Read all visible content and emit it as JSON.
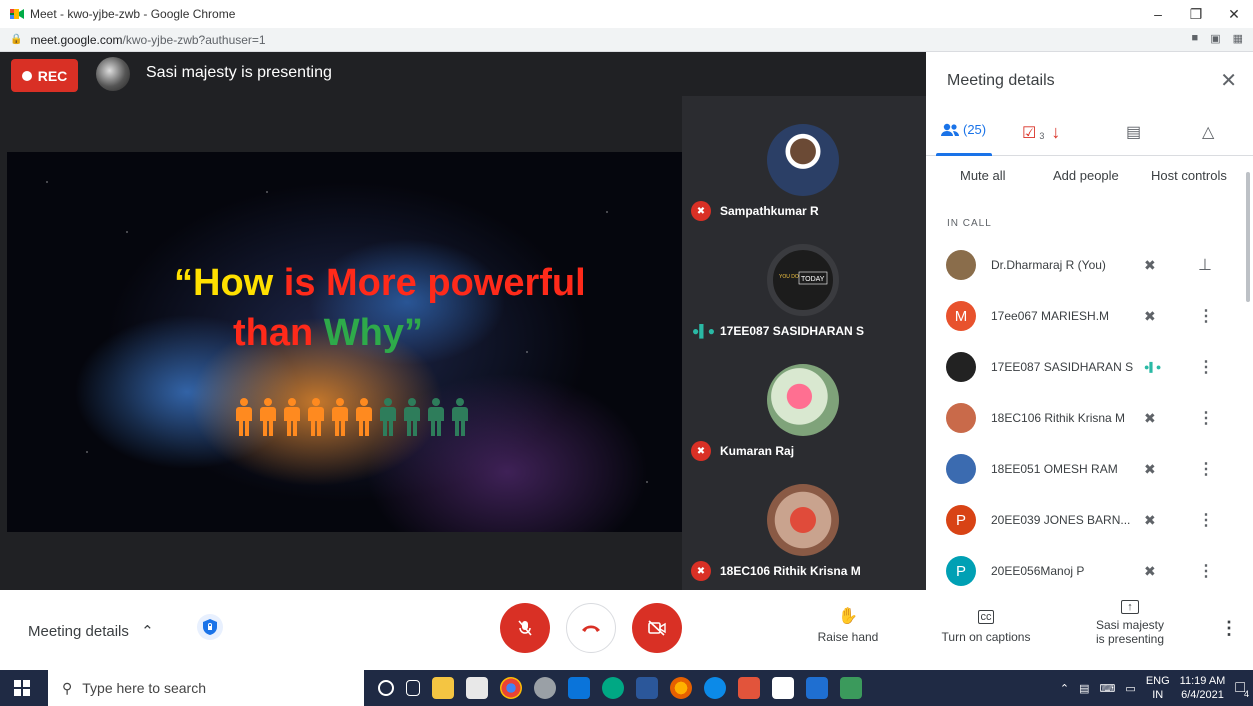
{
  "browser": {
    "title": "Meet - kwo-yjbe-zwb - Google Chrome",
    "url_host": "meet.google.com",
    "url_path": "/kwo-yjbe-zwb?authuser=1"
  },
  "stage": {
    "rec_label": "REC",
    "presenter_text": "Sasi majesty is presenting"
  },
  "slide": {
    "line1": [
      {
        "text": "“How ",
        "color": "#ffe000"
      },
      {
        "text": "is More powerful",
        "color": "#ff2a1a"
      }
    ],
    "line2": [
      {
        "text": "than ",
        "color": "#ff2a1a"
      },
      {
        "text": "Why”",
        "color": "#2eaa4a"
      }
    ],
    "people_orange": 6,
    "people_green": 4,
    "colors": {
      "orange": "#ff8a1f",
      "green": "#2e7d5b"
    }
  },
  "tiles": [
    {
      "name": "Sampathkumar R",
      "state": "muted"
    },
    {
      "name": "17EE087 SASIDHARAN S",
      "state": "speaking"
    },
    {
      "name": "Kumaran Raj",
      "state": "muted"
    },
    {
      "name": "18EC106 Rithik Krisna M",
      "state": "muted"
    }
  ],
  "panel": {
    "title": "Meeting details",
    "people_count": "(25)",
    "tasks_count": "3",
    "actions": {
      "mute_all": "Mute all",
      "add_people": "Add people",
      "host_controls": "Host controls"
    },
    "in_call_label": "IN CALL",
    "participants": [
      {
        "name": "Dr.Dharmaraj R (You)",
        "initial": "",
        "color": "#8a6d4b"
      },
      {
        "name": "17ee067 MARIESH.M",
        "initial": "M",
        "color": "#e8522d"
      },
      {
        "name": "17EE087 SASIDHARAN S",
        "initial": "",
        "color": "#222222"
      },
      {
        "name": "18EC106 Rithik Krisna M",
        "initial": "",
        "color": "#c96a4a"
      },
      {
        "name": "18EE051 OMESH RAM",
        "initial": "",
        "color": "#3b6bb0"
      },
      {
        "name": "20EE039 JONES BARN...",
        "initial": "P",
        "color": "#d84315"
      },
      {
        "name": "20EE056Manoj P",
        "initial": "P",
        "color": "#00a0b4"
      }
    ]
  },
  "bottombar": {
    "meeting_details": "Meeting details",
    "raise_hand": "Raise hand",
    "captions": "Turn on captions",
    "presenting_line1": "Sasi majesty",
    "presenting_line2": "is presenting"
  },
  "taskbar": {
    "search_placeholder": "Type here to search",
    "lang_line1": "ENG",
    "lang_line2": "IN",
    "time": "11:19 AM",
    "date": "6/4/2021",
    "notif_count": "4"
  }
}
